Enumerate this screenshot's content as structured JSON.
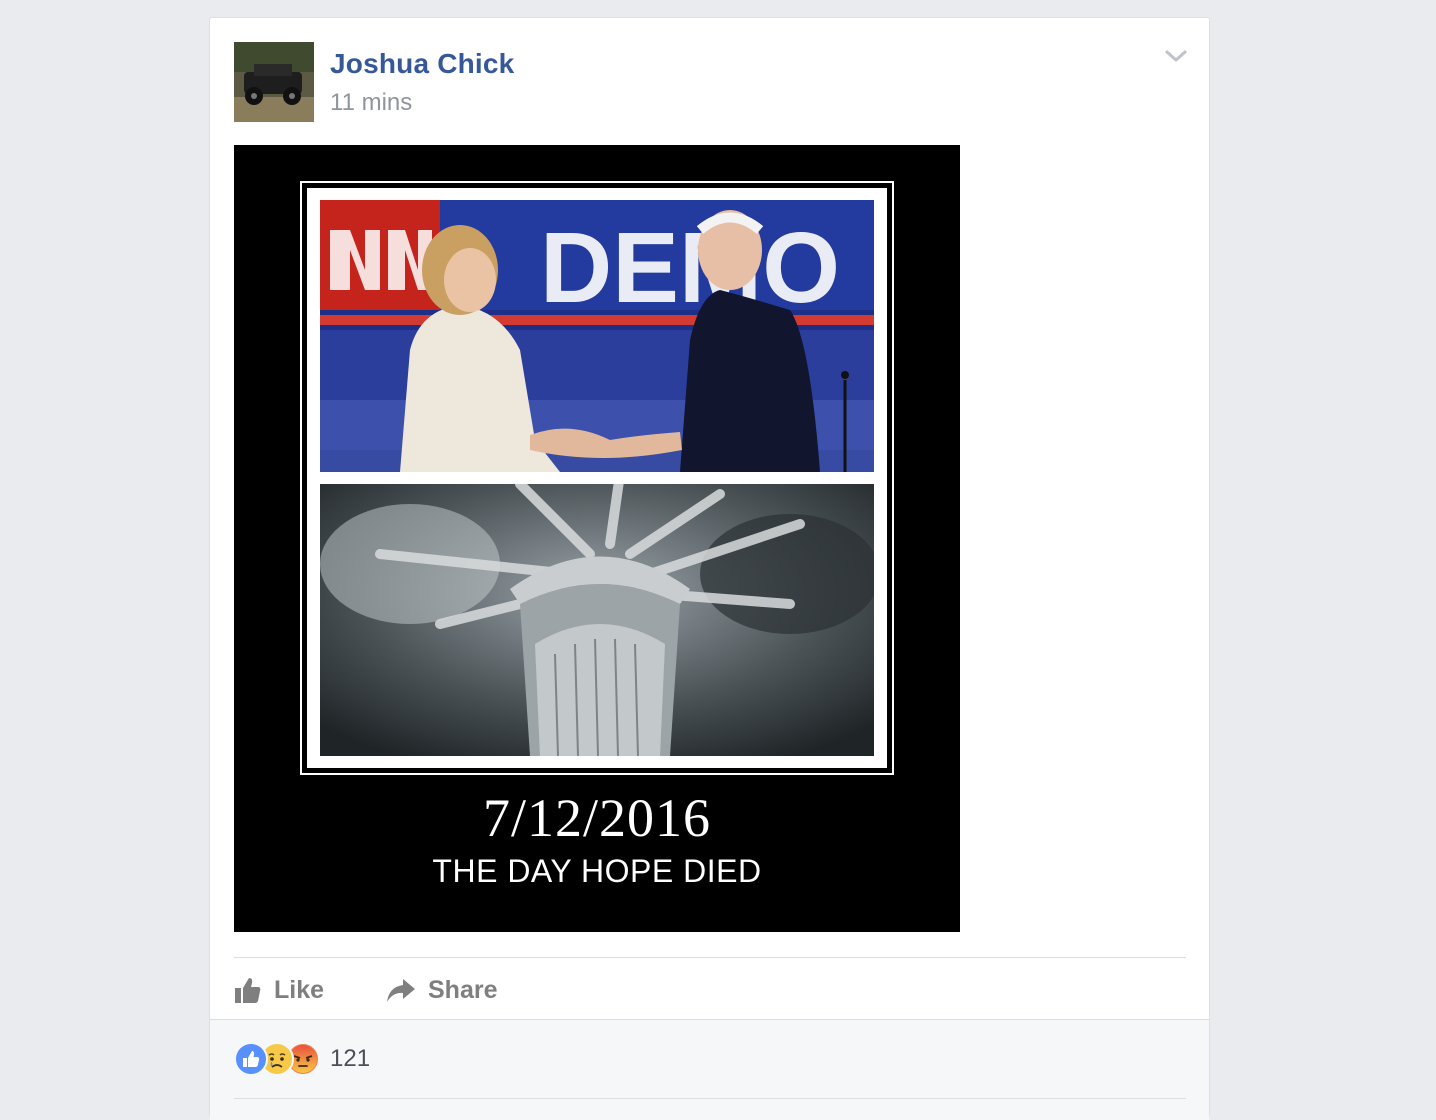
{
  "post": {
    "author": "Joshua Chick",
    "timestamp": "11 mins",
    "image": {
      "caption_date": "7/12/2016",
      "caption_line": "THE DAY HOPE DIED"
    }
  },
  "actions": {
    "like_label": "Like",
    "share_label": "Share"
  },
  "reactions": {
    "types": [
      "like-icon",
      "sad-icon",
      "angry-icon"
    ],
    "count": "121"
  },
  "colors": {
    "background": "#e9ebee",
    "author_link": "#365899",
    "timestamp": "#90949c",
    "like_blue": "#5890ff",
    "action_gray": "#7f7f7f"
  }
}
